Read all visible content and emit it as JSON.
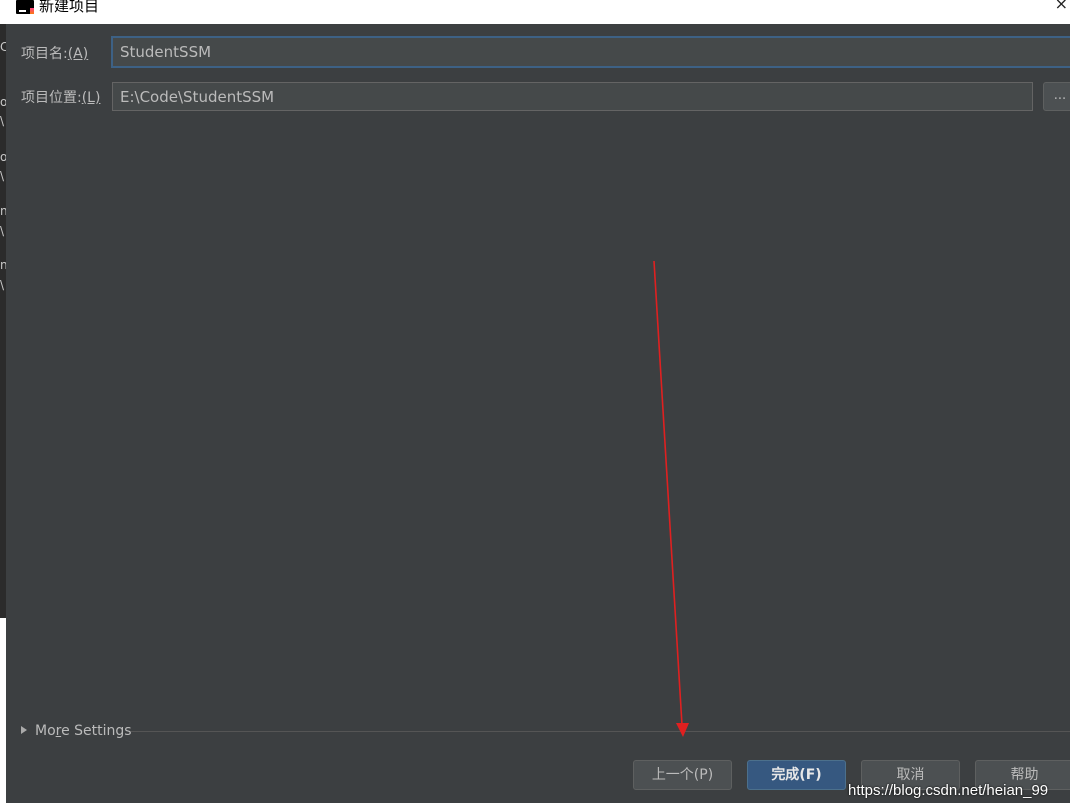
{
  "window": {
    "title": "新建项目",
    "close_glyph": "×"
  },
  "form": {
    "project_name_label": "项目名:",
    "project_name_mnemonic": "(A)",
    "project_name_value": "StudentSSM",
    "project_location_label": "项目位置:",
    "project_location_mnemonic": "(L)",
    "project_location_value": "E:\\Code\\StudentSSM",
    "browse_label": "..."
  },
  "more_settings": {
    "label_pre": "Mo",
    "label_mnemonic": "r",
    "label_post": "e Settings"
  },
  "buttons": {
    "previous": "上一个(P)",
    "finish": "完成(F)",
    "cancel": "取消",
    "help": "帮助"
  },
  "background_window_glyphs": [
    "C",
    "o",
    "\\",
    "o",
    "\\",
    "n",
    "\\",
    "n",
    "\\"
  ],
  "annotation": {
    "arrow_color": "#e02020"
  },
  "watermark": "https://blog.csdn.net/heian_99",
  "colors": {
    "dialog_bg": "#3c3f41",
    "field_bg": "#45494a",
    "focus_border": "#3d6185",
    "primary_button": "#365880"
  }
}
